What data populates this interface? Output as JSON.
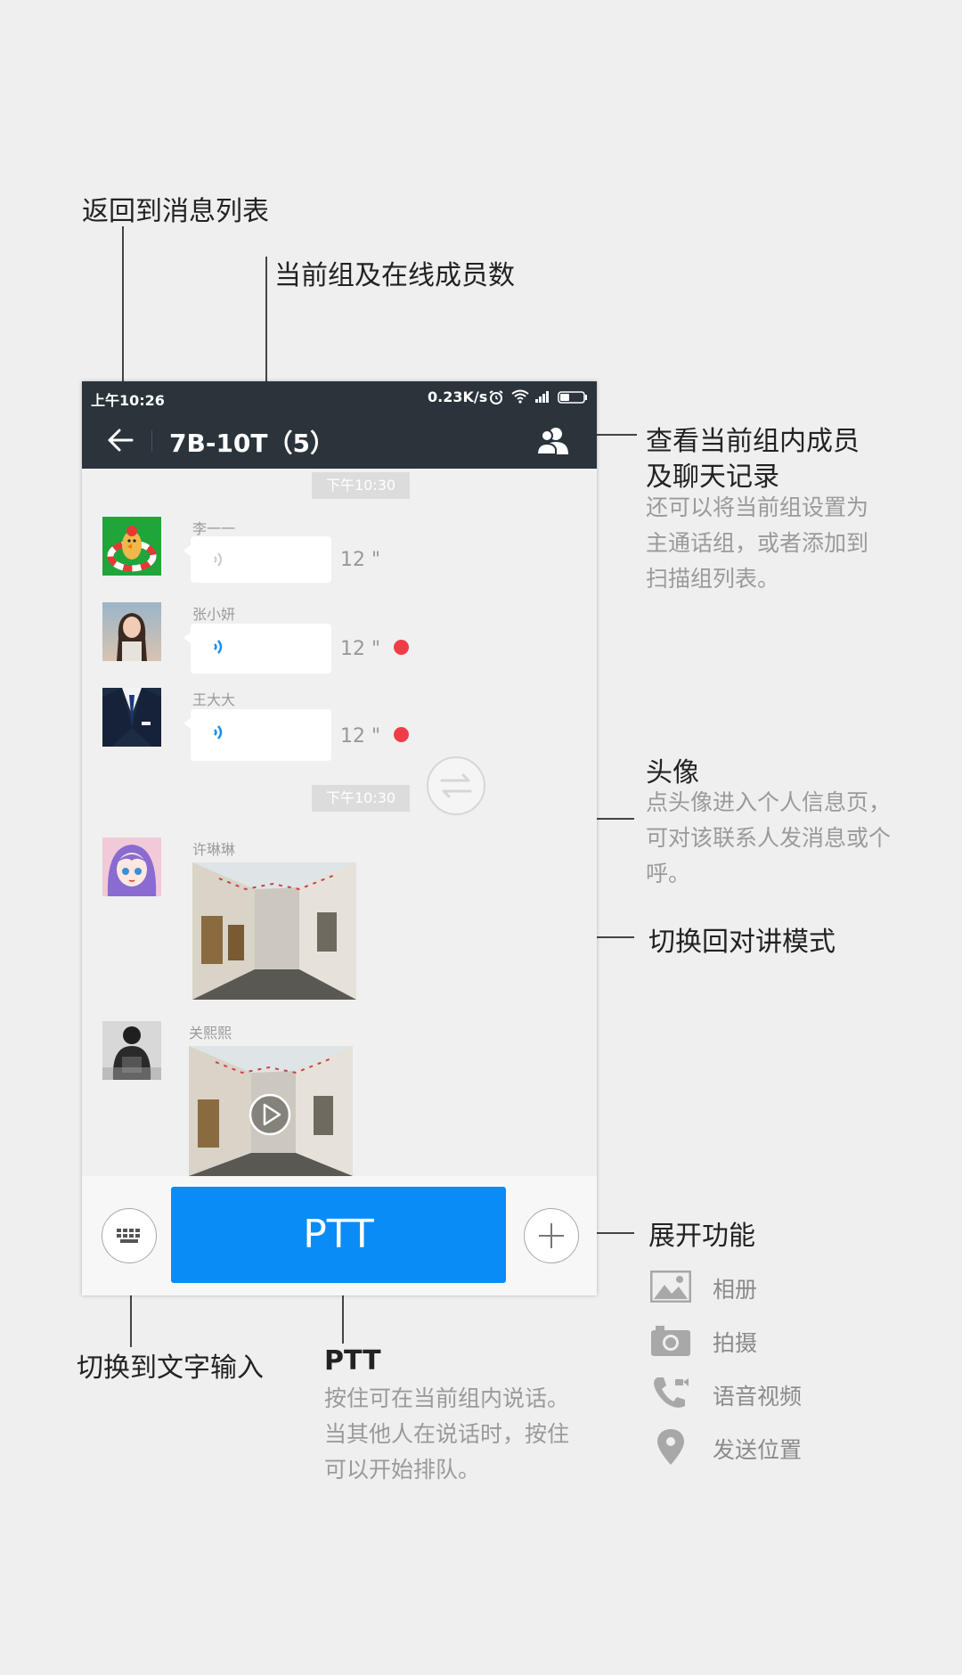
{
  "annotations": {
    "back": {
      "title": "返回到消息列表"
    },
    "group": {
      "title": "当前组及在线成员数"
    },
    "members": {
      "title_line1": "查看当前组内成员",
      "title_line2": "及聊天记录",
      "desc": [
        "还可以将当前组设置为",
        "主通话组，或者添加到",
        "扫描组列表。"
      ]
    },
    "avatar": {
      "title": "头像",
      "desc": [
        "点头像进入个人信息页，",
        "可对该联系人发消息或个",
        "呼。"
      ]
    },
    "switch_mode": {
      "title": "切换回对讲模式"
    },
    "expand": {
      "title": "展开功能",
      "features": [
        {
          "label": "相册",
          "icon": "image-icon"
        },
        {
          "label": "拍摄",
          "icon": "camera-icon"
        },
        {
          "label": "语音视频",
          "icon": "phone-icon"
        },
        {
          "label": "发送位置",
          "icon": "location-pin-icon"
        }
      ]
    },
    "keyboard": {
      "title": "切换到文字输入"
    },
    "ptt": {
      "title": "PTT",
      "desc": [
        "按住可在当前组内说话。",
        "当其他人在说话时，按住",
        "可以开始排队。"
      ]
    }
  },
  "phone": {
    "status_bar": {
      "time": "上午10:26",
      "speed": "0.23K/s"
    },
    "title_bar": {
      "title": "7B-10T（5）"
    },
    "timestamps": [
      "下午10:30",
      "下午10:30"
    ],
    "messages": [
      {
        "sender": "李一一",
        "type": "voice",
        "duration": "12 \"",
        "unread": false
      },
      {
        "sender": "张小妍",
        "type": "voice",
        "duration": "12 \"",
        "unread": true
      },
      {
        "sender": "王大大",
        "type": "voice",
        "duration": "12 \"",
        "unread": true
      },
      {
        "sender": "许琳琳",
        "type": "image"
      },
      {
        "sender": "关熙熙",
        "type": "video"
      }
    ],
    "ptt_label": "PTT"
  },
  "colors": {
    "header_bg": "#2b333b",
    "ptt_blue": "#0a8cf7",
    "unread_red": "#ef3d48",
    "voice_blue": "#1a8ff0"
  }
}
